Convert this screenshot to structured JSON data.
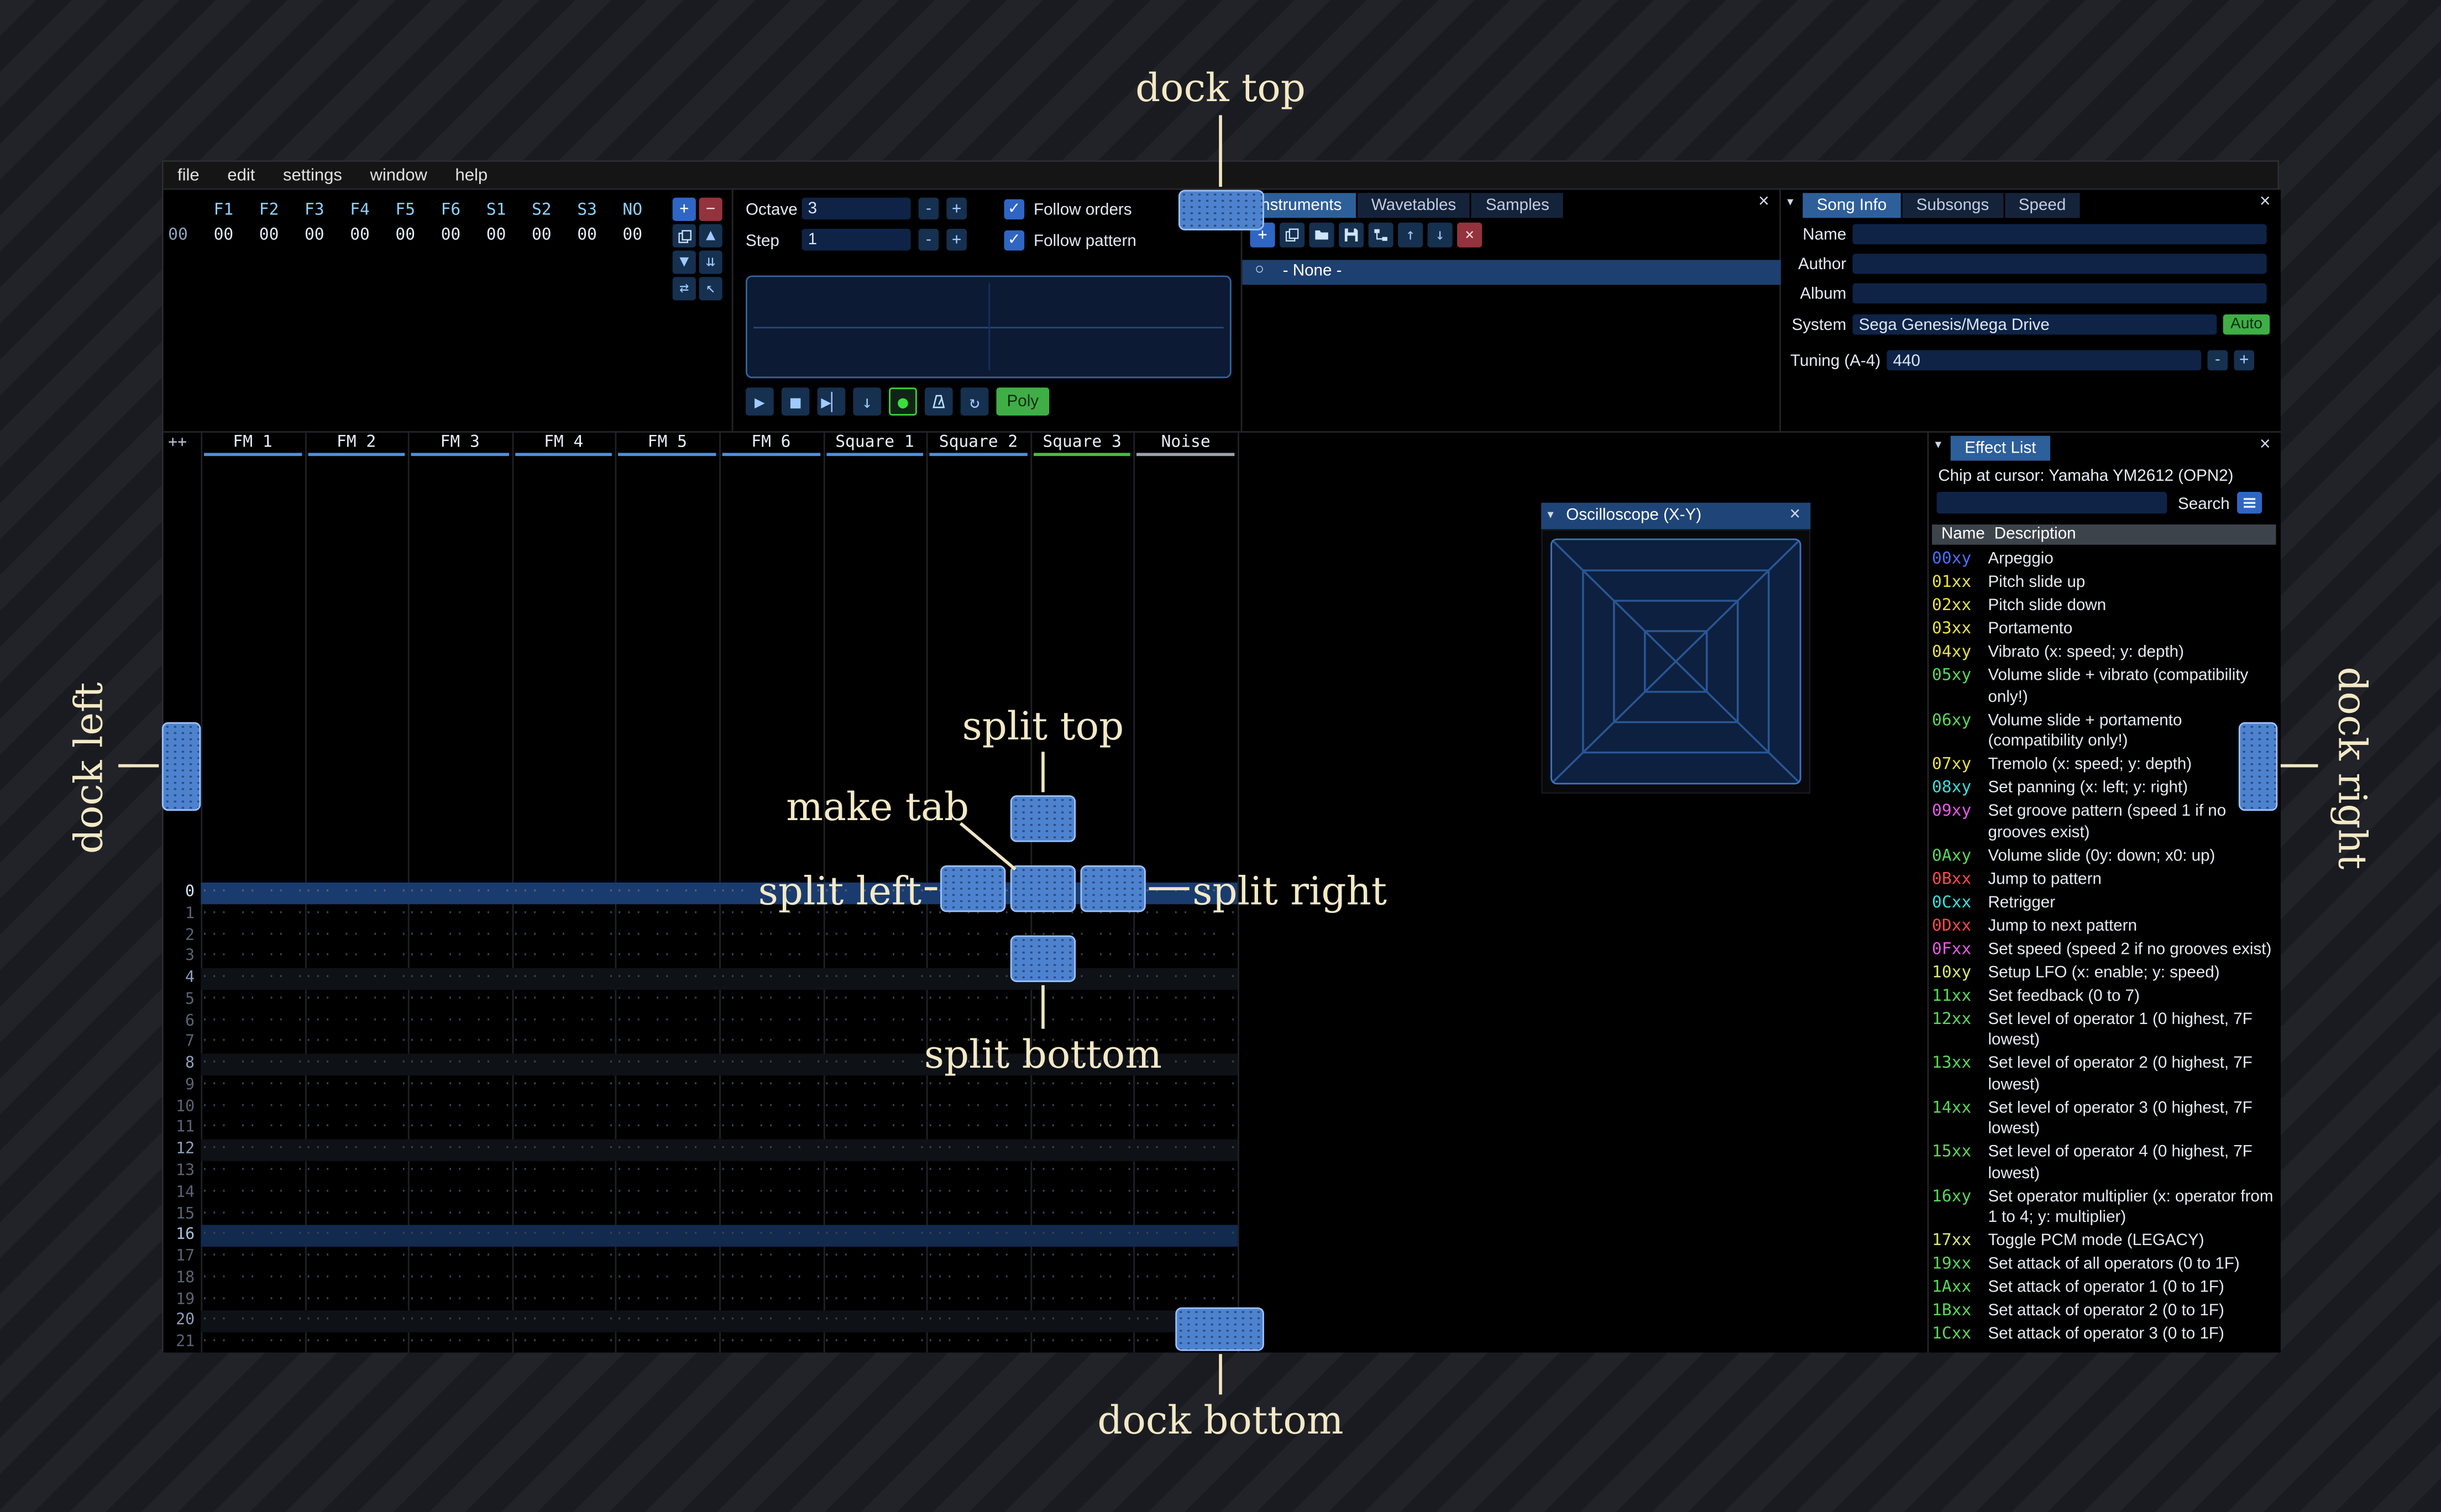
{
  "icons": {
    "collapse": "▾",
    "close": "×",
    "check": "✓",
    "radio": "○"
  },
  "menu": {
    "items": [
      "file",
      "edit",
      "settings",
      "window",
      "help"
    ]
  },
  "orders": {
    "columns": [
      "F1",
      "F2",
      "F3",
      "F4",
      "F5",
      "F6",
      "S1",
      "S2",
      "S3",
      "NO"
    ],
    "row_index": "00",
    "row_values": [
      "00",
      "00",
      "00",
      "00",
      "00",
      "00",
      "00",
      "00",
      "00",
      "00"
    ],
    "buttons": [
      {
        "name": "add-order-button",
        "glyph": "+",
        "style": "primary"
      },
      {
        "name": "remove-order-button",
        "glyph": "−",
        "style": "danger"
      },
      {
        "name": "duplicate-order-button",
        "icon": "duplicate-icon"
      },
      {
        "name": "order-up-button",
        "glyph": "▲"
      },
      {
        "name": "order-down-button",
        "glyph": "▼"
      },
      {
        "name": "deep-clone-order-button",
        "glyph": "⇊"
      },
      {
        "name": "exchange-order-button",
        "glyph": "⇄"
      },
      {
        "name": "order-edit-mode-button",
        "glyph": "↖"
      }
    ]
  },
  "controls": {
    "octave_label": "Octave",
    "octave_value": "3",
    "step_label": "Step",
    "step_value": "1",
    "minus_label": "-",
    "plus_label": "+",
    "follow_orders_label": "Follow orders",
    "follow_pattern_label": "Follow pattern",
    "transport": [
      {
        "name": "play-button",
        "glyph": "▶"
      },
      {
        "name": "stop-button",
        "glyph": "■"
      },
      {
        "name": "play-pattern-button",
        "glyph": "▶▏"
      },
      {
        "name": "step-row-button",
        "glyph": "↓"
      },
      {
        "name": "edit-toggle-button",
        "glyph": "●",
        "style": "edit"
      },
      {
        "name": "metronome-button",
        "icon": "metronome-icon"
      },
      {
        "name": "repeat-pattern-button",
        "glyph": "↻"
      }
    ],
    "poly_label": "Poly"
  },
  "instruments": {
    "tabs": [
      "Instruments",
      "Wavetables",
      "Samples"
    ],
    "active_tab_index": 0,
    "toolbar": [
      {
        "name": "add-instrument-button",
        "glyph": "+",
        "style": "primary"
      },
      {
        "name": "duplicate-instrument-button",
        "icon": "duplicate-icon"
      },
      {
        "name": "open-instrument-button",
        "icon": "folder-icon"
      },
      {
        "name": "save-instrument-button",
        "icon": "floppy-icon"
      },
      {
        "name": "instrument-folders-button",
        "icon": "tree-icon"
      },
      {
        "name": "instrument-up-button",
        "glyph": "↑"
      },
      {
        "name": "instrument-down-button",
        "glyph": "↓"
      },
      {
        "name": "delete-instrument-button",
        "glyph": "×",
        "style": "danger"
      }
    ],
    "list_item": "- None -"
  },
  "song_info": {
    "tabs": [
      "Song Info",
      "Subsongs",
      "Speed"
    ],
    "active_tab_index": 0,
    "name_label": "Name",
    "name_value": "",
    "author_label": "Author",
    "author_value": "",
    "album_label": "Album",
    "album_value": "",
    "system_label": "System",
    "system_value": "Sega Genesis/Mega Drive",
    "auto_label": "Auto",
    "tuning_label": "Tuning (A-4)",
    "tuning_value": "440",
    "minus_label": "-",
    "plus_label": "+"
  },
  "pattern": {
    "corner_label": "++",
    "channels": [
      {
        "label": "FM 1",
        "color": "#4f8fdf"
      },
      {
        "label": "FM 2",
        "color": "#4f8fdf"
      },
      {
        "label": "FM 3",
        "color": "#4f8fdf"
      },
      {
        "label": "FM 4",
        "color": "#4f8fdf"
      },
      {
        "label": "FM 5",
        "color": "#4f8fdf"
      },
      {
        "label": "FM 6",
        "color": "#4f8fdf"
      },
      {
        "label": "Square 1",
        "color": "#4f8fdf"
      },
      {
        "label": "Square 2",
        "color": "#4f8fdf"
      },
      {
        "label": "Square 3",
        "color": "#44bf44"
      },
      {
        "label": "Noise",
        "color": "#9aa2ac"
      }
    ],
    "row_numbers": [
      "0",
      "1",
      "2",
      "3",
      "4",
      "5",
      "6",
      "7",
      "8",
      "9",
      "10",
      "11",
      "12",
      "13",
      "14",
      "15",
      "16",
      "17",
      "18",
      "19",
      "20",
      "21"
    ],
    "cell_placeholder": "··· ·· ·· ···"
  },
  "oscilloscope": {
    "title": "Oscilloscope (X-Y)"
  },
  "effect_list": {
    "title": "Effect List",
    "chip_line": "Chip at cursor: Yamaha YM2612 (OPN2)",
    "search_label": "Search",
    "search_value": "",
    "columns": {
      "name": "Name",
      "description": "Description"
    },
    "effects": [
      {
        "code": "00xy",
        "color": "#4a6fff",
        "desc": "Arpeggio"
      },
      {
        "code": "01xx",
        "color": "#e8e23f",
        "desc": "Pitch slide up"
      },
      {
        "code": "02xx",
        "color": "#e8e23f",
        "desc": "Pitch slide down"
      },
      {
        "code": "03xx",
        "color": "#e8e23f",
        "desc": "Portamento"
      },
      {
        "code": "04xy",
        "color": "#e8e23f",
        "desc": "Vibrato (x: speed; y: depth)"
      },
      {
        "code": "05xy",
        "color": "#58d858",
        "desc": "Volume slide + vibrato (compatibility only!)"
      },
      {
        "code": "06xy",
        "color": "#58d858",
        "desc": "Volume slide + portamento (compatibility only!)"
      },
      {
        "code": "07xy",
        "color": "#e8e23f",
        "desc": "Tremolo (x: speed; y: depth)"
      },
      {
        "code": "08xy",
        "color": "#36e0e0",
        "desc": "Set panning (x: left; y: right)"
      },
      {
        "code": "09xy",
        "color": "#e858e8",
        "desc": "Set groove pattern (speed 1 if no grooves exist)"
      },
      {
        "code": "0Axy",
        "color": "#58d858",
        "desc": "Volume slide (0y: down; x0: up)"
      },
      {
        "code": "0Bxx",
        "color": "#ff4848",
        "desc": "Jump to pattern"
      },
      {
        "code": "0Cxx",
        "color": "#36e0e0",
        "desc": "Retrigger"
      },
      {
        "code": "0Dxx",
        "color": "#ff4848",
        "desc": "Jump to next pattern"
      },
      {
        "code": "0Fxx",
        "color": "#e858e8",
        "desc": "Set speed (speed 2 if no grooves exist)"
      },
      {
        "code": "10xy",
        "color": "#d8e86f",
        "desc": "Setup LFO (x: enable; y: speed)"
      },
      {
        "code": "11xx",
        "color": "#58d858",
        "desc": "Set feedback (0 to 7)"
      },
      {
        "code": "12xx",
        "color": "#58d858",
        "desc": "Set level of operator 1 (0 highest, 7F lowest)"
      },
      {
        "code": "13xx",
        "color": "#58d858",
        "desc": "Set level of operator 2 (0 highest, 7F lowest)"
      },
      {
        "code": "14xx",
        "color": "#58d858",
        "desc": "Set level of operator 3 (0 highest, 7F lowest)"
      },
      {
        "code": "15xx",
        "color": "#58d858",
        "desc": "Set level of operator 4 (0 highest, 7F lowest)"
      },
      {
        "code": "16xy",
        "color": "#58d858",
        "desc": "Set operator multiplier (x: operator from 1 to 4; y: multiplier)"
      },
      {
        "code": "17xx",
        "color": "#d8e86f",
        "desc": "Toggle PCM mode (LEGACY)"
      },
      {
        "code": "19xx",
        "color": "#58d858",
        "desc": "Set attack of all operators (0 to 1F)"
      },
      {
        "code": "1Axx",
        "color": "#58d858",
        "desc": "Set attack of operator 1 (0 to 1F)"
      },
      {
        "code": "1Bxx",
        "color": "#58d858",
        "desc": "Set attack of operator 2 (0 to 1F)"
      },
      {
        "code": "1Cxx",
        "color": "#58d858",
        "desc": "Set attack of operator 3 (0 to 1F)"
      }
    ]
  },
  "overlays": {
    "dock_top": "dock top",
    "dock_bottom": "dock bottom",
    "dock_left": "dock left",
    "dock_right": "dock right",
    "split_top": "split top",
    "split_bottom": "split bottom",
    "split_left": "split left",
    "split_right": "split right",
    "make_tab": "make tab"
  }
}
